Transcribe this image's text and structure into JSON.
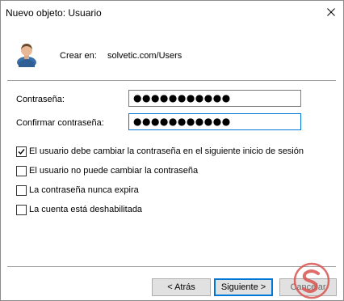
{
  "window": {
    "title": "Nuevo objeto: Usuario"
  },
  "header": {
    "icon": "user-icon",
    "create_in_label": "Crear en:",
    "create_in_value": "solvetic.com/Users"
  },
  "fields": {
    "password_label": "Contraseña:",
    "password_value": "●●●●●●●●●●●",
    "confirm_label": "Confirmar contraseña:",
    "confirm_value": "●●●●●●●●●●●"
  },
  "options": [
    {
      "label": "El usuario debe cambiar la contraseña en el siguiente inicio de sesión",
      "checked": true
    },
    {
      "label": "El usuario no puede cambiar la contraseña",
      "checked": false
    },
    {
      "label": "La contraseña nunca expira",
      "checked": false
    },
    {
      "label": "La cuenta está deshabilitada",
      "checked": false
    }
  ],
  "buttons": {
    "back": "< Atrás",
    "next": "Siguiente >",
    "cancel": "Cancelar"
  },
  "colors": {
    "accent": "#0078d7",
    "button_bg": "#e1e1e1",
    "watermark": "#d9534f"
  }
}
